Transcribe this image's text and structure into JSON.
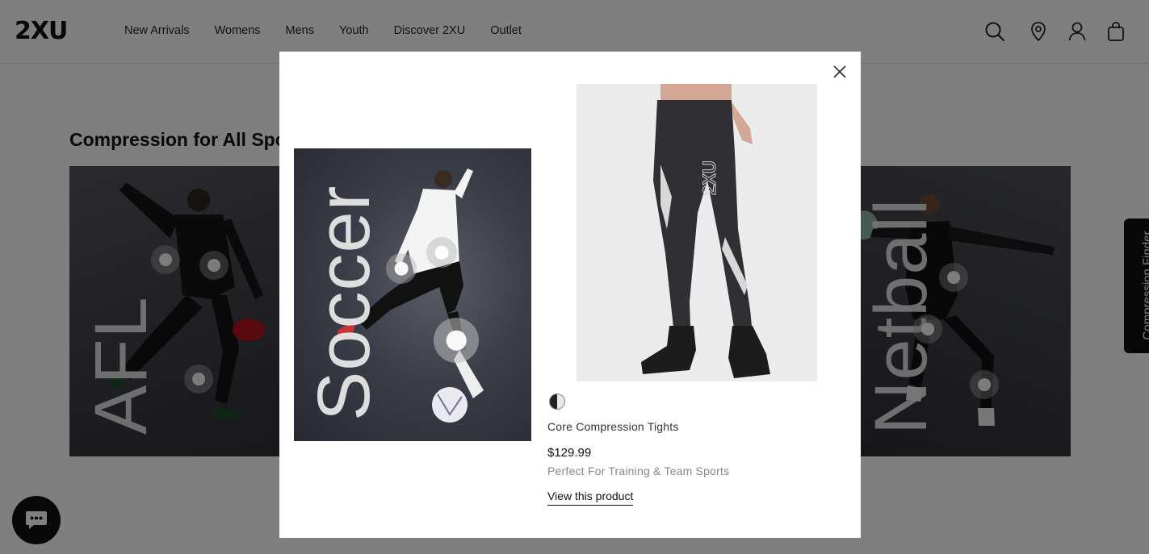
{
  "brand": {
    "logo": "2XU"
  },
  "nav": {
    "items": [
      "New Arrivals",
      "Womens",
      "Mens",
      "Youth",
      "Discover 2XU",
      "Outlet"
    ]
  },
  "header_icons": [
    "search-icon",
    "location-pin-icon",
    "account-icon",
    "bag-icon"
  ],
  "section": {
    "title": "Compression for All Sports",
    "cards": [
      {
        "label": "AFL"
      },
      {
        "label": "Soccer"
      },
      {
        "label": "Netball"
      }
    ]
  },
  "side_tab": {
    "label": "Compression Finder"
  },
  "modal": {
    "lifestyle_label": "Soccer",
    "product": {
      "name": "Core Compression Tights",
      "price": "$129.99",
      "tagline": "Perfect For Training & Team Sports",
      "link_label": "View this product",
      "print": "2XU",
      "swatch": "black/white"
    }
  },
  "colors": {
    "overlay": "#000000",
    "card_background": "#3e3f47",
    "text": "#111111",
    "muted_text": "#888888"
  }
}
